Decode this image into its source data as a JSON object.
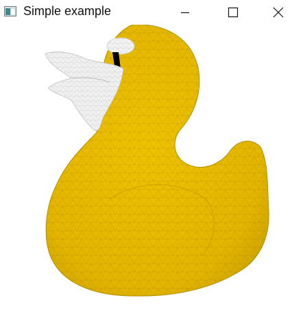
{
  "window": {
    "title": "Simple example",
    "icons": {
      "app": "app-window-icon",
      "minimize": "minimize-icon",
      "maximize": "maximize-icon",
      "close": "close-icon"
    }
  },
  "scene": {
    "object": "rubber-duck-mesh",
    "colors": {
      "body": "#e6b800",
      "body_shade": "#c99f00",
      "wireframe": "#a88700",
      "beak": "#f2f2f2",
      "beak_wire": "#c8c8c8",
      "eye": "#000000",
      "eye_white": "#f4f4f4"
    }
  }
}
